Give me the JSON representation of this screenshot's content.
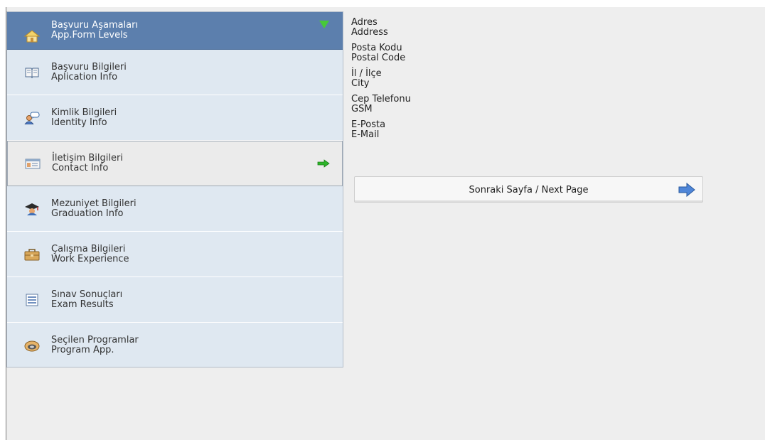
{
  "menu": {
    "header": {
      "line1": "Başvuru Aşamaları",
      "line2": "App.Form Levels",
      "icon": "home-icon"
    },
    "items": [
      {
        "line1": "Başvuru Bilgileri",
        "line2": "Aplication Info",
        "icon": "book-icon"
      },
      {
        "line1": "Kimlik Bilgileri",
        "line2": "Identity Info",
        "icon": "user-chat-icon"
      },
      {
        "line1": "İletişim Bilgileri",
        "line2": "Contact Info",
        "icon": "contact-card-icon"
      },
      {
        "line1": "Mezuniyet Bilgileri",
        "line2": "Graduation Info",
        "icon": "graduation-cap-icon"
      },
      {
        "line1": "Çalışma Bilgileri",
        "line2": "Work Experience",
        "icon": "briefcase-icon"
      },
      {
        "line1": "Sınav Sonuçları",
        "line2": "Exam Results",
        "icon": "exam-sheet-icon"
      },
      {
        "line1": "Seçilen Programlar",
        "line2": "Program App.",
        "icon": "program-box-icon"
      }
    ],
    "active_index": 2
  },
  "fields": [
    {
      "tr": "Adres",
      "en": "Address"
    },
    {
      "tr": "Posta Kodu",
      "en": "Postal Code"
    },
    {
      "tr": "İl / İlçe",
      "en": "City"
    },
    {
      "tr": "Cep Telefonu",
      "en": "GSM"
    },
    {
      "tr": "E-Posta",
      "en": "E-Mail"
    }
  ],
  "next_button": {
    "label": "Sonraki Sayfa / Next Page",
    "icon": "arrow-right-icon"
  },
  "colors": {
    "header_bg": "#5c7fad",
    "menu_bg": "#dfe8f1",
    "active_bg": "#ebebeb",
    "accent_green": "#2db52a",
    "page_bg": "#eeeeee"
  }
}
